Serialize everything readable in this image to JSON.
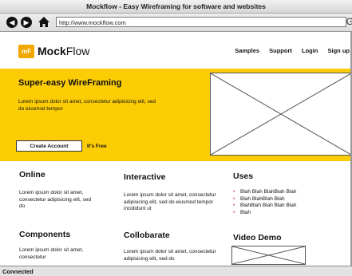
{
  "window": {
    "title": "Mockflow - Easy Wireframing for software and websites"
  },
  "browser": {
    "url": "http://www.mockflow.com",
    "back_icon": "◀",
    "forward_icon": "▶",
    "edge_glyph": "G",
    "status": "Connected"
  },
  "brand": {
    "logo_mark": "mF",
    "name_bold": "Mock",
    "name_rest": "Flow"
  },
  "nav": {
    "items": [
      {
        "label": "Samples"
      },
      {
        "label": "Support"
      },
      {
        "label": "Login"
      },
      {
        "label": "Sign up"
      }
    ]
  },
  "hero": {
    "title": "Super-easy WireFraming",
    "description": "Lorem ipsum dolor sit amet, consectetur adipisicing elit, sed do eiusmod tempor",
    "cta_label": "Create Account",
    "cta_note": "It's Free"
  },
  "features": {
    "online": {
      "title": "Online",
      "text": "Lorem ipsum dolor sit amet, consectetur adipisicing elit, sed do"
    },
    "interactive": {
      "title": "Interactive",
      "text": "Lorem ipsum dolor sit amet, consectetur adipisicing elit, sed do eiusmod tempor incididunt ut"
    },
    "uses": {
      "title": "Uses",
      "items": [
        "Blah Blah BlahBlah Blah",
        "Blah BlahBlah Blah",
        "BlahBlah Blah Blah Blah",
        "Blah"
      ]
    },
    "components": {
      "title": "Components",
      "text": "Lorem ipsum dolor sit amet, consectetur"
    },
    "collaborate": {
      "title": "Collobarate",
      "text": "Lorem ipsum dolor sit amet, consectetur adipisicing elit, sed do"
    },
    "video": {
      "title": "Video Demo"
    }
  },
  "colors": {
    "hero_bg": "#fccc05",
    "logo_bg": "#f0a800",
    "bullet": "#c0392b"
  }
}
